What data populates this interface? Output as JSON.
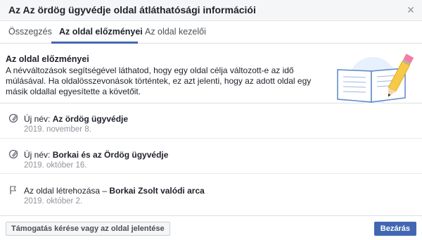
{
  "dialog": {
    "title": "Az Az ördög ügyvédje oldal átláthatósági információi",
    "close_icon": "close-icon"
  },
  "tabs": [
    {
      "label": "Összegzés",
      "active": false
    },
    {
      "label": "Az oldal előzményei",
      "active": true
    },
    {
      "label": "Az oldal kezelői",
      "active": false
    }
  ],
  "intro": {
    "heading": "Az oldal előzményei",
    "text": "A névváltozások segítségével láthatod, hogy egy oldal célja változott-e az idő múlásával. Ha oldalösszevonások történtek, ez azt jelenti, hogy az adott oldal egy másik oldallal egyesítette a követőit.",
    "illustration": "book-and-pencil-illustration"
  },
  "history": [
    {
      "icon": "edit-icon",
      "prefix": "Új név: ",
      "name": "Az ördög ügyvédje",
      "date": "2019. november 8."
    },
    {
      "icon": "edit-icon",
      "prefix": "Új név: ",
      "name": "Borkai és az Ördög ügyvédje",
      "date": "2019. október 16."
    },
    {
      "icon": "flag-icon",
      "prefix": "Az oldal létrehozása – ",
      "name": "Borkai Zsolt valódi arca",
      "date": "2019. október 2."
    }
  ],
  "footer": {
    "report_label": "Támogatás kérése vagy az oldal jelentése",
    "close_label": "Bezárás"
  },
  "colors": {
    "accent": "#4267b2",
    "header_bg": "#f5f6f7",
    "muted_text": "#90949c"
  }
}
